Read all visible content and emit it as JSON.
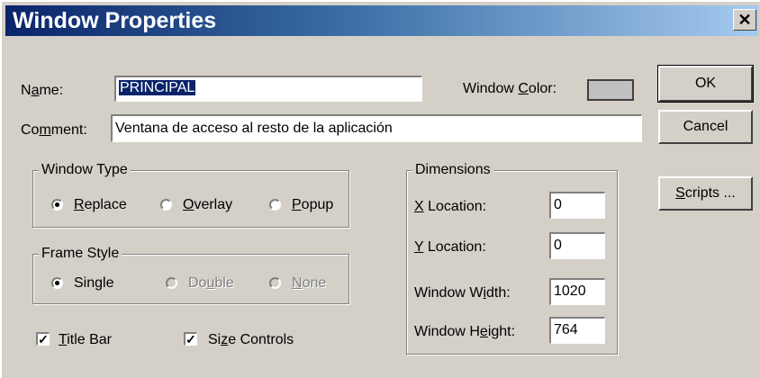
{
  "window": {
    "title": "Window Properties",
    "close_glyph": "✕"
  },
  "name": {
    "label_pre": "N",
    "label_u": "a",
    "label_post": "me:",
    "value": "PRINCIPAL"
  },
  "window_color": {
    "label_pre": "Window ",
    "label_u": "C",
    "label_post": "olor:",
    "swatch_color": "#c0c0c0"
  },
  "comment": {
    "label_pre": "Co",
    "label_u": "m",
    "label_post": "ment:",
    "value": "Ventana de acceso al resto de la aplicación"
  },
  "buttons": {
    "ok": "OK",
    "cancel": "Cancel",
    "scripts_u": "S",
    "scripts_post": "cripts ..."
  },
  "window_type": {
    "title": "Window Type",
    "options": [
      {
        "u": "R",
        "post": "eplace",
        "checked": true
      },
      {
        "u": "O",
        "post": "verlay",
        "checked": false
      },
      {
        "u": "P",
        "post": "opup",
        "checked": false
      }
    ]
  },
  "frame_style": {
    "title": "Frame Style",
    "single": {
      "pre": "Sin",
      "u": "g",
      "post": "le"
    },
    "double": {
      "pre": "Do",
      "u": "u",
      "post": "ble"
    },
    "none": {
      "pre": "",
      "u": "N",
      "post": "one"
    }
  },
  "checkboxes": {
    "title_bar": {
      "u": "T",
      "post": "itle Bar",
      "checked": true
    },
    "size_controls": {
      "pre": "Si",
      "u": "z",
      "post": "e Controls",
      "checked": true
    },
    "check_glyph": "✓"
  },
  "dimensions": {
    "title": "Dimensions",
    "x_location": {
      "u": "X",
      "post": " Location:",
      "value": "0"
    },
    "y_location": {
      "u": "Y",
      "post": " Location:",
      "value": "0"
    },
    "width": {
      "pre": "Window W",
      "u": "i",
      "post": "dth:",
      "value": "1020"
    },
    "height": {
      "pre": "Window H",
      "u": "e",
      "post": "ight:",
      "value": "764"
    }
  }
}
